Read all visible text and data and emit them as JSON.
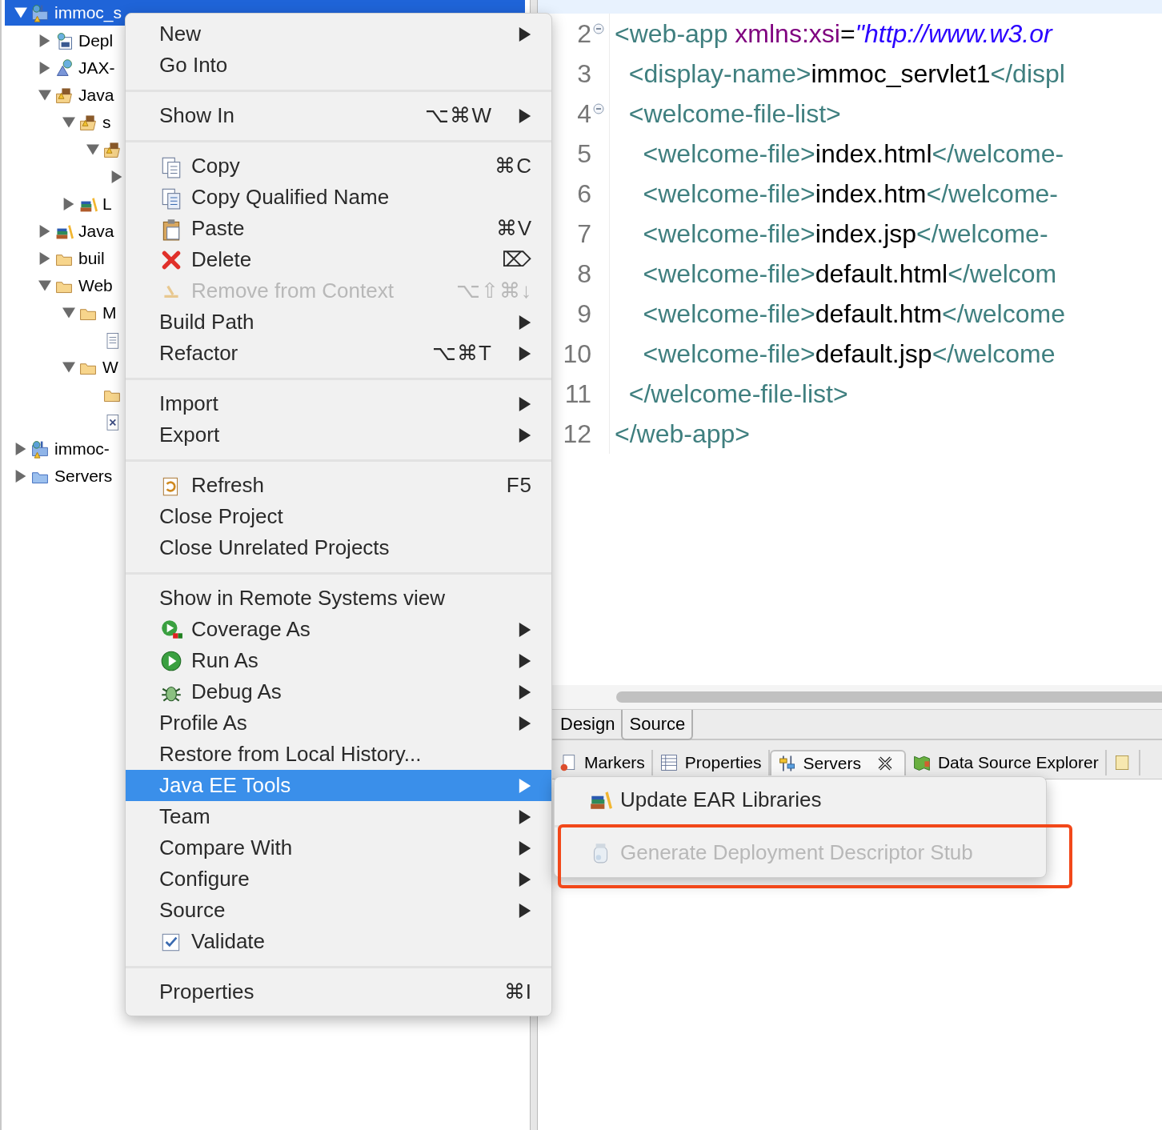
{
  "tree": {
    "items": [
      {
        "label": "immoc_s",
        "kind": "project",
        "expanded": true,
        "selected": true,
        "children": [
          {
            "label": "Depl",
            "kind": "deploy",
            "expanded": false,
            "selected": false
          },
          {
            "label": "JAX-",
            "kind": "jaxws",
            "expanded": false,
            "selected": false
          },
          {
            "label": "Java",
            "kind": "pkgroot",
            "expanded": true,
            "selected": false,
            "children": [
              {
                "label": "s",
                "kind": "pkgroot",
                "expanded": true,
                "selected": false,
                "children": [
                  {
                    "kind": "pkgroot",
                    "expanded": true,
                    "selected": false,
                    "children": [
                      {
                        "expanded": false,
                        "selected": false
                      }
                    ]
                  }
                ]
              },
              {
                "label": "L",
                "kind": "library",
                "expanded": false,
                "selected": false
              }
            ]
          },
          {
            "label": "Java",
            "kind": "library",
            "expanded": false,
            "selected": false
          },
          {
            "label": "buil",
            "kind": "folder",
            "expanded": false,
            "selected": false
          },
          {
            "label": "Web",
            "kind": "folder",
            "expanded": true,
            "selected": false,
            "children": [
              {
                "label": "M",
                "kind": "folder",
                "expanded": true,
                "selected": false,
                "children": [
                  {
                    "kind": "file",
                    "selected": false
                  }
                ]
              },
              {
                "label": "W",
                "kind": "folder",
                "expanded": true,
                "selected": false,
                "children": [
                  {
                    "kind": "folder",
                    "selected": false
                  },
                  {
                    "kind": "xmlfile",
                    "selected": false
                  }
                ]
              }
            ]
          }
        ]
      },
      {
        "label": "immoc-",
        "kind": "project",
        "expanded": false,
        "selected": false
      },
      {
        "label": "Servers",
        "kind": "serverfolder",
        "expanded": false,
        "selected": false
      }
    ]
  },
  "editor": {
    "lines": [
      {
        "number": "2",
        "foldable": true,
        "segments": [
          {
            "kind": "tag",
            "text": "<web-app"
          },
          {
            "kind": "attr",
            "text": " xmlns:xsi"
          },
          {
            "kind": "plain",
            "text": "="
          },
          {
            "kind": "string",
            "text": "\"http://www.w3.or"
          }
        ]
      },
      {
        "number": "3",
        "foldable": false,
        "segments": [
          {
            "kind": "tag",
            "text": "  <display-name>"
          },
          {
            "kind": "plain",
            "text": "immoc_servlet1"
          },
          {
            "kind": "tag",
            "text": "</displ"
          }
        ]
      },
      {
        "number": "4",
        "foldable": true,
        "segments": [
          {
            "kind": "tag",
            "text": "  <welcome-file-list>"
          }
        ]
      },
      {
        "number": "5",
        "foldable": false,
        "segments": [
          {
            "kind": "tag",
            "text": "    <welcome-file>"
          },
          {
            "kind": "plain",
            "text": "index.html"
          },
          {
            "kind": "tag",
            "text": "</welcome-"
          }
        ]
      },
      {
        "number": "6",
        "foldable": false,
        "segments": [
          {
            "kind": "tag",
            "text": "    <welcome-file>"
          },
          {
            "kind": "plain",
            "text": "index.htm"
          },
          {
            "kind": "tag",
            "text": "</welcome-"
          }
        ]
      },
      {
        "number": "7",
        "foldable": false,
        "segments": [
          {
            "kind": "tag",
            "text": "    <welcome-file>"
          },
          {
            "kind": "plain",
            "text": "index.jsp"
          },
          {
            "kind": "tag",
            "text": "</welcome-"
          }
        ]
      },
      {
        "number": "8",
        "foldable": false,
        "segments": [
          {
            "kind": "tag",
            "text": "    <welcome-file>"
          },
          {
            "kind": "plain",
            "text": "default.html"
          },
          {
            "kind": "tag",
            "text": "</welcom"
          }
        ]
      },
      {
        "number": "9",
        "foldable": false,
        "segments": [
          {
            "kind": "tag",
            "text": "    <welcome-file>"
          },
          {
            "kind": "plain",
            "text": "default.htm"
          },
          {
            "kind": "tag",
            "text": "</welcome"
          }
        ]
      },
      {
        "number": "10",
        "foldable": false,
        "segments": [
          {
            "kind": "tag",
            "text": "    <welcome-file>"
          },
          {
            "kind": "plain",
            "text": "default.jsp"
          },
          {
            "kind": "tag",
            "text": "</welcome"
          }
        ]
      },
      {
        "number": "11",
        "foldable": false,
        "segments": [
          {
            "kind": "tag",
            "text": "  </welcome-file-list>"
          }
        ]
      },
      {
        "number": "12",
        "foldable": false,
        "segments": [
          {
            "kind": "tag",
            "text": "</web-app>"
          }
        ]
      }
    ]
  },
  "editor_tabs": [
    {
      "label": "Design",
      "selected": false
    },
    {
      "label": "Source",
      "selected": true
    }
  ],
  "panel_tabs": [
    {
      "label": "Markers",
      "kind": "markers",
      "selected": false,
      "closable": false
    },
    {
      "label": "Properties",
      "kind": "properties",
      "selected": false,
      "closable": false
    },
    {
      "label": "Servers",
      "kind": "servers",
      "selected": true,
      "closable": true
    },
    {
      "label": "Data Source Explorer",
      "kind": "datasource",
      "selected": false,
      "closable": false
    },
    {
      "kind": "generic",
      "selected": false,
      "closable": false
    }
  ],
  "context_menu": {
    "sections": [
      {
        "items": [
          {
            "label": "New",
            "submenu": true,
            "disabled": false,
            "selected": false
          },
          {
            "label": "Go Into",
            "submenu": false,
            "disabled": false,
            "selected": false
          }
        ]
      },
      {
        "items": [
          {
            "label": "Show In",
            "shortcut": "⌥⌘W",
            "submenu": true,
            "disabled": false,
            "selected": false
          }
        ]
      },
      {
        "items": [
          {
            "label": "Copy",
            "kind": "copy",
            "shortcut": "⌘C",
            "submenu": false,
            "disabled": false,
            "selected": false
          },
          {
            "label": "Copy Qualified Name",
            "kind": "copyname",
            "submenu": false,
            "disabled": false,
            "selected": false
          },
          {
            "label": "Paste",
            "kind": "paste",
            "shortcut": "⌘V",
            "submenu": false,
            "disabled": false,
            "selected": false
          },
          {
            "label": "Delete",
            "kind": "delete",
            "shortcut": "⌦",
            "submenu": false,
            "disabled": false,
            "selected": false
          },
          {
            "label": "Remove from Context",
            "kind": "remove",
            "shortcut": "⌥⇧⌘↓",
            "submenu": false,
            "disabled": true,
            "selected": false
          },
          {
            "label": "Build Path",
            "submenu": true,
            "disabled": false,
            "selected": false
          },
          {
            "label": "Refactor",
            "shortcut": "⌥⌘T",
            "submenu": true,
            "disabled": false,
            "selected": false
          }
        ]
      },
      {
        "items": [
          {
            "label": "Import",
            "submenu": true,
            "disabled": false,
            "selected": false
          },
          {
            "label": "Export",
            "submenu": true,
            "disabled": false,
            "selected": false
          }
        ]
      },
      {
        "items": [
          {
            "label": "Refresh",
            "kind": "refresh",
            "shortcut": "F5",
            "submenu": false,
            "disabled": false,
            "selected": false
          },
          {
            "label": "Close Project",
            "submenu": false,
            "disabled": false,
            "selected": false
          },
          {
            "label": "Close Unrelated Projects",
            "submenu": false,
            "disabled": false,
            "selected": false
          }
        ]
      },
      {
        "items": [
          {
            "label": "Show in Remote Systems view",
            "submenu": false,
            "disabled": false,
            "selected": false
          },
          {
            "label": "Coverage As",
            "kind": "coverage",
            "submenu": true,
            "disabled": false,
            "selected": false
          },
          {
            "label": "Run As",
            "kind": "run",
            "submenu": true,
            "disabled": false,
            "selected": false
          },
          {
            "label": "Debug As",
            "kind": "debug",
            "submenu": true,
            "disabled": false,
            "selected": false
          },
          {
            "label": "Profile As",
            "submenu": true,
            "disabled": false,
            "selected": false
          },
          {
            "label": "Restore from Local History...",
            "submenu": false,
            "disabled": false,
            "selected": false
          },
          {
            "label": "Java EE Tools",
            "submenu": true,
            "disabled": false,
            "selected": true
          },
          {
            "label": "Team",
            "submenu": true,
            "disabled": false,
            "selected": false
          },
          {
            "label": "Compare With",
            "submenu": true,
            "disabled": false,
            "selected": false
          },
          {
            "label": "Configure",
            "submenu": true,
            "disabled": false,
            "selected": false
          },
          {
            "label": "Source",
            "submenu": true,
            "disabled": false,
            "selected": false
          },
          {
            "label": "Validate",
            "kind": "validate",
            "submenu": false,
            "disabled": false,
            "selected": false
          }
        ]
      },
      {
        "items": [
          {
            "label": "Properties",
            "shortcut": "⌘I",
            "submenu": false,
            "disabled": false,
            "selected": false
          }
        ]
      }
    ]
  },
  "submenu": {
    "sections": [
      {
        "items": [
          {
            "label": "Update EAR Libraries",
            "kind": "library",
            "submenu": false,
            "disabled": false,
            "selected": false,
            "highlighted": false
          }
        ]
      },
      {
        "items": [
          {
            "label": "Generate Deployment Descriptor Stub",
            "kind": "jar",
            "submenu": false,
            "disabled": true,
            "selected": false,
            "highlighted": true
          }
        ]
      }
    ]
  }
}
